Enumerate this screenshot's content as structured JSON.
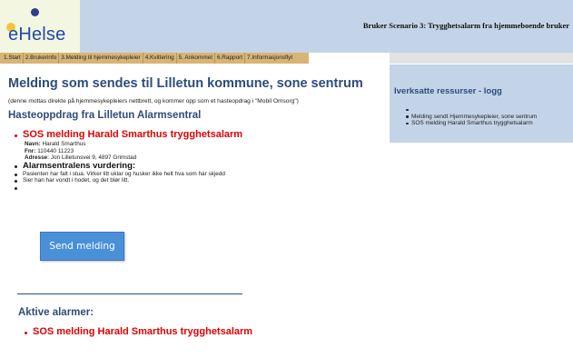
{
  "header": {
    "logo_text": "eHelse",
    "title": "Bruker Scenario 3: Trygghetsalarm fra hjemmeboende bruker"
  },
  "nav": {
    "tabs": [
      "1.Start",
      "2.Brukerinfo",
      "3.Melding til hjemmesykepleier",
      "4.Kvittering",
      "5. Ankommet",
      "6.Rapport",
      "7.Informasjonsflyt"
    ]
  },
  "main": {
    "title": "Melding som sendes til Lilletun kommune, sone sentrum",
    "intro": "(denne mottas direkte på hjemmesykepleiers nettbrett, og kommer opp som et hasteopdrag i \"Mobil Omsorg\")",
    "section_title": "Hasteoppdrag fra Lilletun Alarmsentral",
    "sos_title": "SOS melding Harald Smarthus trygghetsalarm",
    "details": {
      "navn_label": "Navn:",
      "navn_value": "Harald Smarthus",
      "fnr_label": "Fnr:",
      "fnr_value": "110440 11223",
      "adresse_label": "Adresse",
      "adresse_value": ": Jon Lilletunsvei 9, 4897 Grimstad"
    },
    "assessment_title": "Alarmsentralens vurdering:",
    "assessment_items": [
      "Pasienten har falt i stua. Virker litt uklar og husker ikke helt hva som har skjedd",
      "Sier han har vondt i hodet, og det blør litt."
    ],
    "send_button": "Send melding",
    "active_title": "Aktive alarmer:",
    "active_items": [
      "SOS melding Harald Smarthus trygghetsalarm"
    ]
  },
  "right_panel": {
    "title": "Iverksatte ressurser - logg",
    "log_items": [
      "Melding sendt Hjemmesykepleier, sone sentrum",
      "SOS melding Harald Smarthus trygghetsalarm"
    ]
  },
  "colors": {
    "header_bg": "#c4d4e8",
    "nav_bg": "#d8b574",
    "title_blue": "#2c4d7a",
    "alert_red": "#e00000",
    "button_blue": "#4a90d9"
  }
}
